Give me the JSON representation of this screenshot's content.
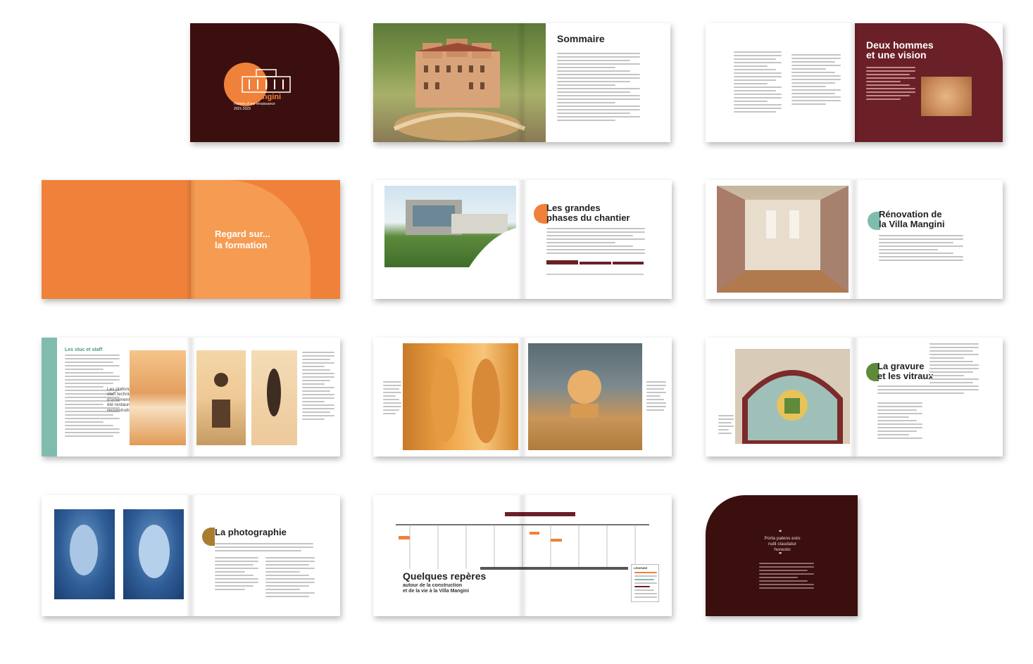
{
  "colors": {
    "maroon": "#3b0f0d",
    "wine": "#6b1f26",
    "orange": "#f0813a",
    "orange_light": "#f59b52",
    "teal": "#7fbcad",
    "gold": "#a87d2e"
  },
  "cover": {
    "title": "Villa Mangini",
    "subtitle": "Histoire d'une renaissance",
    "years": "2021-2023"
  },
  "sommaire": {
    "title": "Sommaire"
  },
  "deux_hommes": {
    "title_line1": "Deux hommes",
    "title_line2": "et une vision"
  },
  "regard": {
    "title_line1": "Regard sur...",
    "title_line2": "la formation"
  },
  "grandes_phases": {
    "title_line1": "Les grandes",
    "title_line2": "phases du chantier"
  },
  "renovation": {
    "title_line1": "Rénovation de",
    "title_line2": "la Villa Mangini"
  },
  "stuc": {
    "title": "Les stuc et staff",
    "quote": "Les plafonds en staff technique d'ornement, ont été restaurés ou reconstruits."
  },
  "gravure": {
    "title_line1": "La gravure",
    "title_line2": "et les vitraux"
  },
  "photographie": {
    "title": "La photographie"
  },
  "reperes": {
    "title": "Quelques repères",
    "subtitle_line1": "autour de la construction",
    "subtitle_line2": "et de la vie à la Villa Mangini",
    "legend_title": "LÉGENDE"
  },
  "back": {
    "quote": "Porta patens esto nulli claudatur honesto"
  }
}
